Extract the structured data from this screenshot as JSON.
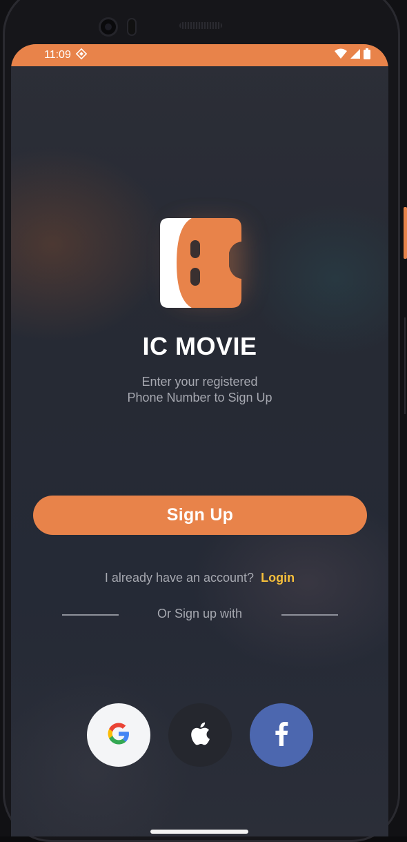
{
  "status_bar": {
    "time": "11:09",
    "icons": [
      "location-icon",
      "wifi-icon",
      "signal-icon",
      "battery-icon"
    ]
  },
  "app": {
    "title": "IC MOVIE",
    "subtitle_line1": "Enter your registered",
    "subtitle_line2": "Phone Number to Sign Up"
  },
  "actions": {
    "signup_label": "Sign Up",
    "have_account_text": "I already have an account?",
    "login_label": "Login",
    "or_signup_text": "Or Sign up with"
  },
  "social": {
    "google_letter": "G",
    "facebook_letter": "f"
  },
  "colors": {
    "accent": "#e8834a",
    "link": "#f6bf3b",
    "facebook": "#4c67af"
  }
}
